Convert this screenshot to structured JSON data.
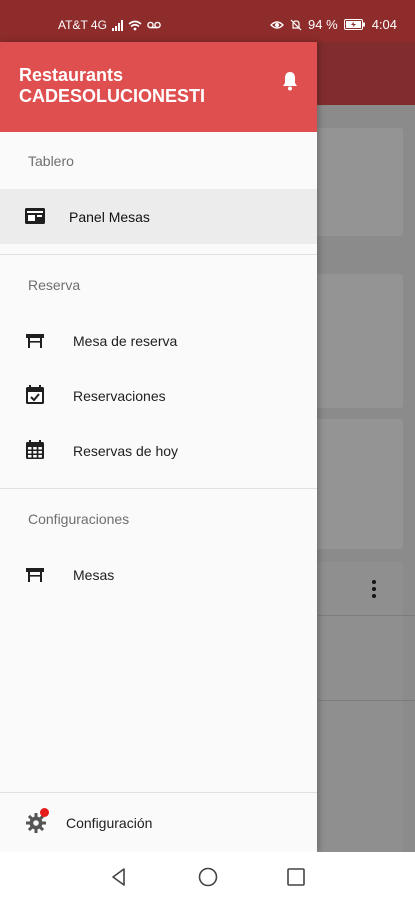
{
  "status_bar": {
    "carrier": "AT&T 4G",
    "battery_percent": "94 %",
    "time": "4:04",
    "icons": [
      "signal-icon",
      "wifi-icon",
      "voicemail-icon",
      "eye-icon",
      "do-not-disturb-icon",
      "battery-charging-icon"
    ]
  },
  "drawer": {
    "title_line1": "Restaurants",
    "title_line2": "CADESOLUCIONESTI",
    "header_color": "#e04f4f",
    "header_icon": "bell-icon",
    "sections": [
      {
        "label": "Tablero",
        "items": [
          {
            "label": "Panel Mesas",
            "icon": "dashboard-panel-icon",
            "active": true
          }
        ]
      },
      {
        "label": "Reserva",
        "items": [
          {
            "label": "Mesa de reserva",
            "icon": "table-icon"
          },
          {
            "label": "Reservaciones",
            "icon": "calendar-check-icon"
          },
          {
            "label": "Reservas de hoy",
            "icon": "calendar-grid-icon"
          }
        ]
      },
      {
        "label": "Configuraciones",
        "items": [
          {
            "label": "Mesas",
            "icon": "table-icon"
          }
        ]
      }
    ],
    "footer": {
      "label": "Configuración",
      "icon": "gear-icon",
      "notification_dot_color": "#e41b1b"
    }
  },
  "nav_bar": {
    "icons": [
      "back-icon",
      "home-icon",
      "recents-icon"
    ]
  }
}
